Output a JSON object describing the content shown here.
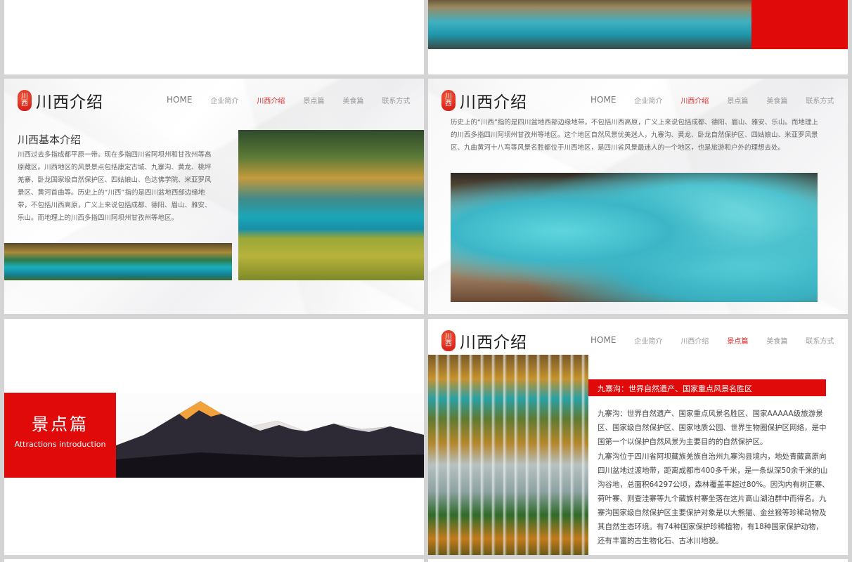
{
  "brand": {
    "seal_chars": [
      "川",
      "西"
    ],
    "title": "川西介绍"
  },
  "nav": {
    "home": "HOME",
    "items": [
      "企业简介",
      "川西介绍",
      "景点篇",
      "美食篇",
      "联系方式"
    ]
  },
  "slide2": {
    "heading": "川西基本介绍",
    "body": "川西过去多指成都平原一带。现在多指四川省阿坝州和甘孜州等高原藏区。川西地区的风景景点包括康定古城、九寨沟、黄龙、桃坪羌寨、卧龙国家级自然保护区、四姑娘山、色达佛学院、米亚罗风景区、黄河首曲等。历史上的“川西”指的是四川盆地西部边缘地带，不包括川西高原，广义上来说包括成都、德阳、眉山、雅安、乐山。而地理上的川西多指四川阿坝州甘孜州等地区。"
  },
  "slide3": {
    "body": "历史上的“川西”指的是四川盆地西部边缘地带，不包括川西高原，广义上来说包括成都、德阳、眉山、雅安、乐山。而地理上的川西多指四川阿坝州甘孜州等地区。这个地区自然风景优美迷人，九寨沟、黄龙、卧龙自然保护区、四姑娘山、米亚罗风景区、九曲黄河十八弯等风景名胜都位于川西地区，是四川省风景最迷人的一个地区，也是旅游和户外的理想去处。"
  },
  "slide4": {
    "title": "景点篇",
    "subtitle": "Attractions introduction"
  },
  "slide5": {
    "banner": "九寨沟：世界自然遗产、国家重点风景名胜区",
    "para1": "九寨沟：世界自然遗产、国家重点风景名胜区、国家AAAAA级旅游景区、国家级自然保护区、国家地质公园、世界生物圈保护区网络，是中国第一个以保护自然风景为主要目的的自然保护区。",
    "para2": "九寨沟位于四川省阿坝藏族羌族自治州九寨沟县境内，地处青藏高原向四川盆地过渡地带，距离成都市400多千米，是一条纵深50余千米的山沟谷地，总面积64297公顷，森林覆盖率超过80%。因沟内有树正寨、荷叶寨、则查洼寨等九个藏族村寨坐落在这片高山湖泊群中而得名。九寨沟国家级自然保护区主要保护对象是以大熊猫、金丝猴等珍稀动物及其自然生态环境。有74种国家保护珍稀植物，有18种国家保护动物，还有丰富的古生物化石、古冰川地貌。"
  },
  "colors": {
    "accent": "#e00a0a",
    "nav_active": "#e02a2a"
  }
}
